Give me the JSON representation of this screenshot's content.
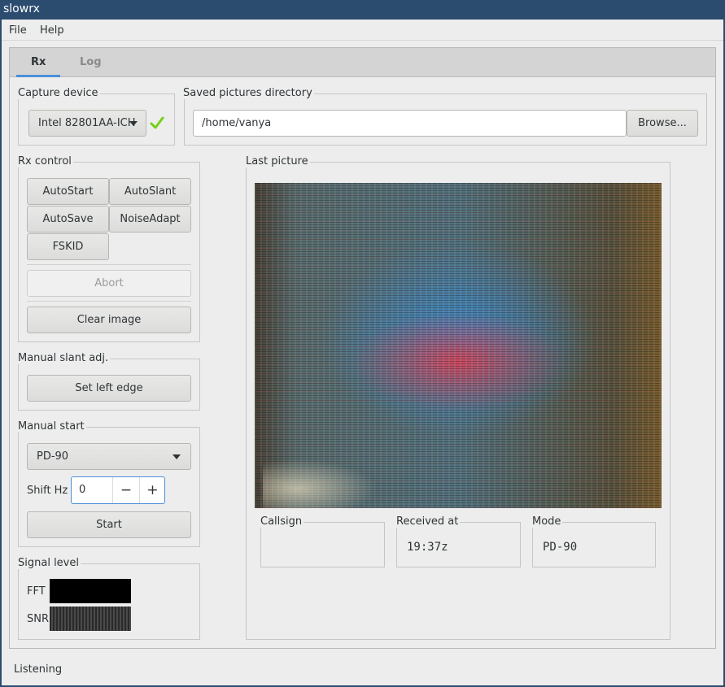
{
  "window": {
    "title": "slowrx"
  },
  "menu": {
    "file": "File",
    "help": "Help"
  },
  "tabs": {
    "rx": "Rx",
    "log": "Log"
  },
  "capture": {
    "label": "Capture device",
    "device": "Intel 82801AA-ICH"
  },
  "saved": {
    "label": "Saved pictures directory",
    "path": "/home/vanya",
    "browse": "Browse..."
  },
  "rx_control": {
    "label": "Rx control",
    "autostart": "AutoStart",
    "autoslant": "AutoSlant",
    "autosave": "AutoSave",
    "noiseadapt": "NoiseAdapt",
    "fskid": "FSKID",
    "abort": "Abort",
    "clear": "Clear image"
  },
  "slant": {
    "label": "Manual slant adj.",
    "set_left_edge": "Set left edge"
  },
  "manual_start": {
    "label": "Manual start",
    "mode": "PD-90",
    "shift_label": "Shift Hz",
    "shift_value": "0",
    "minus": "−",
    "plus": "+",
    "start": "Start"
  },
  "signal": {
    "label": "Signal level",
    "fft": "FFT",
    "snr": "SNR"
  },
  "last_picture": {
    "label": "Last picture"
  },
  "info": {
    "callsign_label": "Callsign",
    "callsign_value": "",
    "received_label": "Received at",
    "received_value": "19:37z",
    "mode_label": "Mode",
    "mode_value": "PD-90"
  },
  "status": {
    "text": "Listening"
  },
  "colors": {
    "titlebar": "#2b4c6f",
    "tab_accent": "#4a90d9",
    "check": "#73d216"
  }
}
